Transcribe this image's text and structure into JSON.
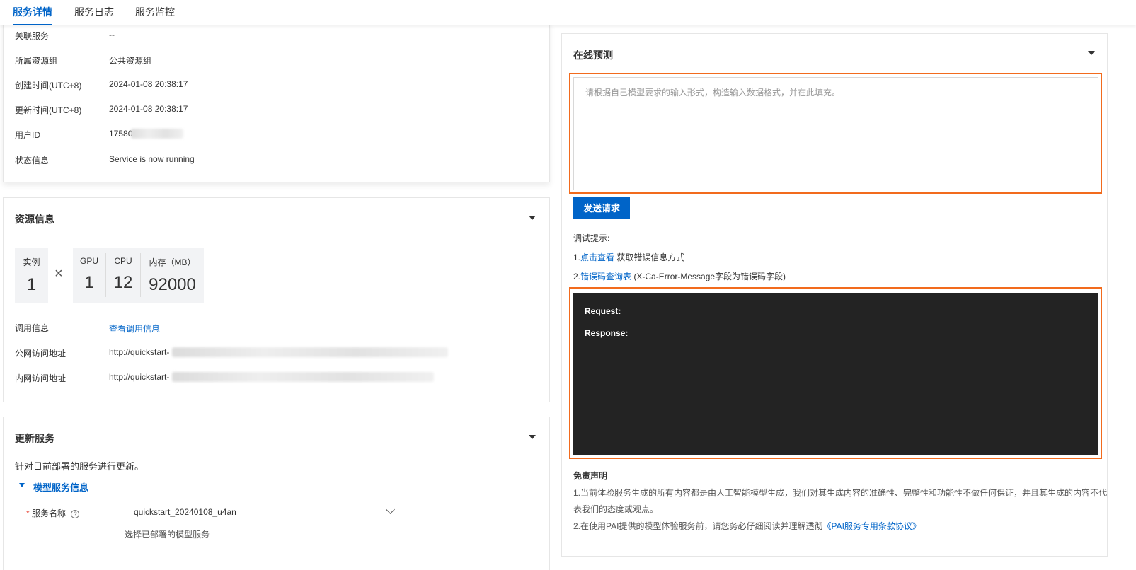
{
  "tabs": [
    {
      "label": "服务详情",
      "active": true
    },
    {
      "label": "服务日志",
      "active": false
    },
    {
      "label": "服务监控",
      "active": false
    }
  ],
  "basic_info": {
    "rows": [
      {
        "label": "关联服务",
        "value": "--"
      },
      {
        "label": "所属资源组",
        "value": "公共资源组"
      },
      {
        "label": "创建时间(UTC+8)",
        "value": "2024-01-08 20:38:17"
      },
      {
        "label": "更新时间(UTC+8)",
        "value": "2024-01-08 20:38:17"
      },
      {
        "label": "用户ID",
        "value": "17580"
      },
      {
        "label": "状态信息",
        "value": "Service is now running"
      }
    ]
  },
  "resource_info": {
    "title": "资源信息",
    "instances": {
      "label": "实例",
      "value": "1"
    },
    "multiply": "×",
    "gpu": {
      "label": "GPU",
      "value": "1"
    },
    "cpu": {
      "label": "CPU",
      "value": "12"
    },
    "memory": {
      "label": "内存（MB）",
      "value": "92000"
    },
    "invoke_label": "调用信息",
    "invoke_link": "查看调用信息",
    "public_label": "公网访问地址",
    "public_value": "http://quickstart-",
    "private_label": "内网访问地址",
    "private_value": "http://quickstart-"
  },
  "update_service": {
    "title": "更新服务",
    "description": "针对目前部署的服务进行更新。",
    "section_title": "模型服务信息",
    "required_mark": "*",
    "name_label": "服务名称",
    "help_icon": "?",
    "name_value": "quickstart_20240108_u4an",
    "name_hint": "选择已部署的模型服务"
  },
  "online_predict": {
    "title": "在线预测",
    "placeholder": "请根据自己模型要求的输入形式，构造输入数据格式，并在此填充。",
    "send_button": "发送请求",
    "tips_title": "调试提示:",
    "tip1_prefix": "1.",
    "tip1_link": "点击查看",
    "tip1_text": " 获取错误信息方式",
    "tip2_prefix": "2.",
    "tip2_link": "错误码查询表",
    "tip2_text": " (X-Ca-Error-Message字段为错误码字段)",
    "request_label": "Request:",
    "response_label": "Response:",
    "disclaimer_title": "免责声明",
    "disclaimer_1a": "1.当前体验服务生成的所有内容都是由人工智能模型生成，我们对其生成内容的准确性、完整性和功能性不做任何保证，并且其生成的内容不代",
    "disclaimer_1b": "表我们的态度或观点。",
    "disclaimer_2_prefix": "2.在使用PAI提供的模型体验服务前，请您务必仔细阅读并理解透彻",
    "disclaimer_2_link": "《PAI服务专用条款协议》"
  },
  "colors": {
    "accent": "#0064c8",
    "highlight": "#f26b1d",
    "console_bg": "#232323"
  }
}
